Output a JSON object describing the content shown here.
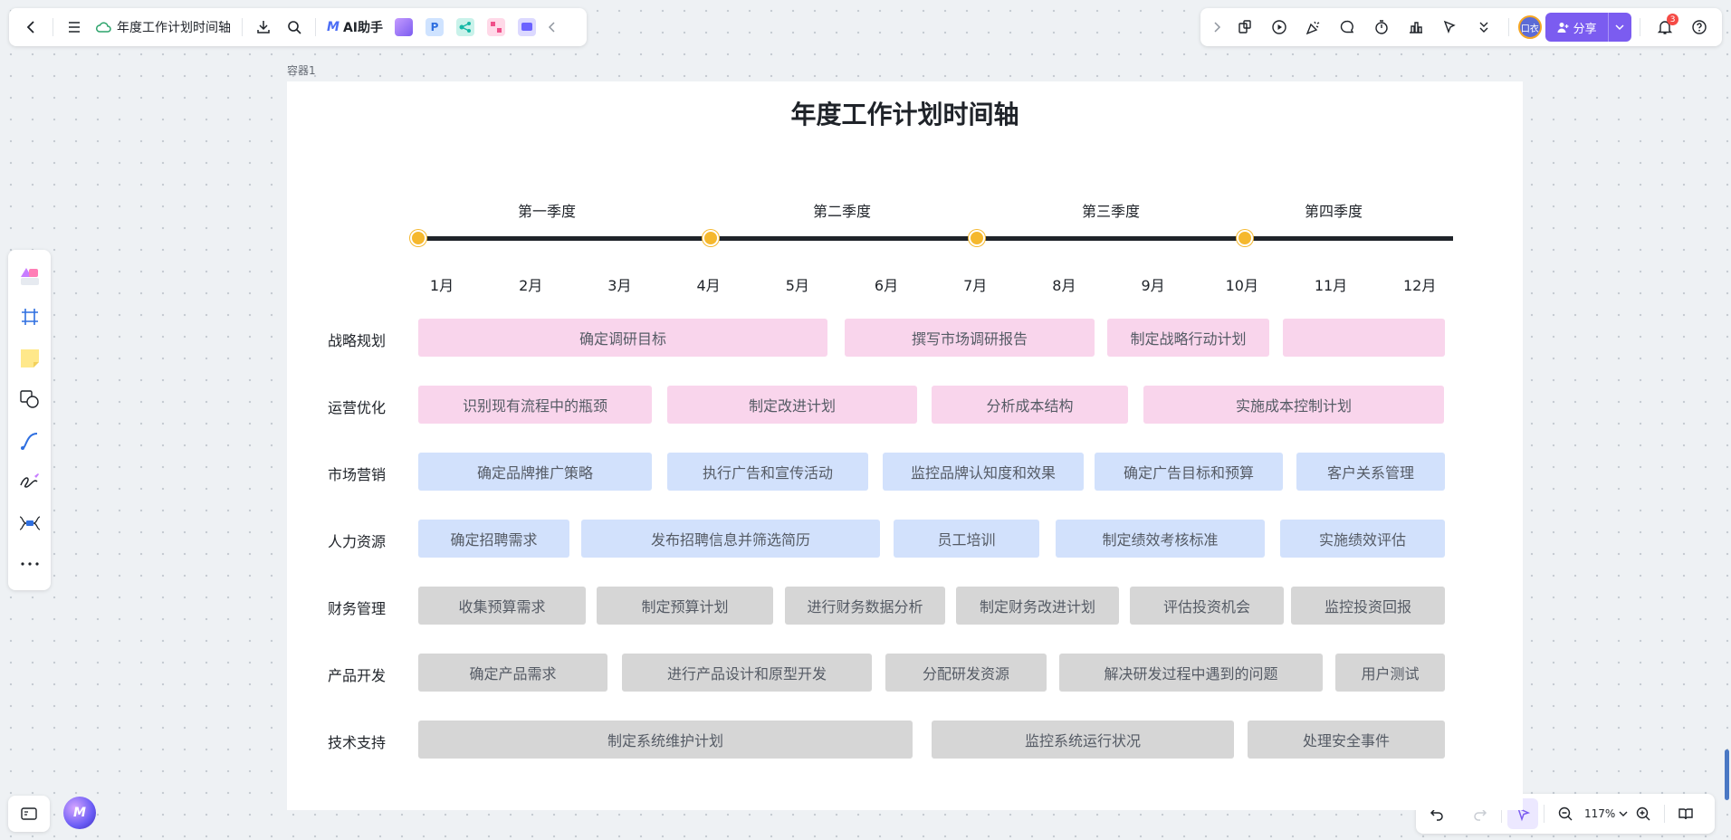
{
  "colors": {
    "accent": "#7b5cf0",
    "timeline_dot": "#f5b82e",
    "task_pink": "#f9d5ec",
    "task_blue": "#d2e1fc",
    "task_gray": "#d6d6d6"
  },
  "toolbar": {
    "doc_title": "年度工作计划时间轴",
    "ai_label": "AI助手",
    "ai_logo": "M",
    "share_label": "分享",
    "avatar_text": "口衣",
    "notification_count": "3",
    "zoom": "117%"
  },
  "canvas": {
    "container_label": "容器1",
    "title": "年度工作计划时间轴",
    "quarters": [
      "第一季度",
      "第二季度",
      "第三季度",
      "第四季度"
    ],
    "months": [
      "1月",
      "2月",
      "3月",
      "4月",
      "5月",
      "6月",
      "7月",
      "8月",
      "9月",
      "10月",
      "11月",
      "12月"
    ]
  },
  "rows": [
    {
      "label": "战略规划",
      "color": "pink",
      "tasks": [
        "确定调研目标",
        "撰写市场调研报告",
        "制定战略行动计划",
        ""
      ]
    },
    {
      "label": "运营优化",
      "color": "pink",
      "tasks": [
        "识别现有流程中的瓶颈",
        "制定改进计划",
        "分析成本结构",
        "实施成本控制计划"
      ]
    },
    {
      "label": "市场营销",
      "color": "blue",
      "tasks": [
        "确定品牌推广策略",
        "执行广告和宣传活动",
        "监控品牌认知度和效果",
        "确定广告目标和预算",
        "客户关系管理"
      ]
    },
    {
      "label": "人力资源",
      "color": "blue",
      "tasks": [
        "确定招聘需求",
        "发布招聘信息并筛选简历",
        "员工培训",
        "制定绩效考核标准",
        "实施绩效评估"
      ]
    },
    {
      "label": "财务管理",
      "color": "gray",
      "tasks": [
        "收集预算需求",
        "制定预算计划",
        "进行财务数据分析",
        "制定财务改进计划",
        "评估投资机会",
        "监控投资回报"
      ]
    },
    {
      "label": "产品开发",
      "color": "gray",
      "tasks": [
        "确定产品需求",
        "进行产品设计和原型开发",
        "分配研发资源",
        "解决研发过程中遇到的问题",
        "用户测试"
      ]
    },
    {
      "label": "技术支持",
      "color": "gray",
      "tasks": [
        "制定系统维护计划",
        "监控系统运行状况",
        "处理安全事件"
      ]
    }
  ]
}
